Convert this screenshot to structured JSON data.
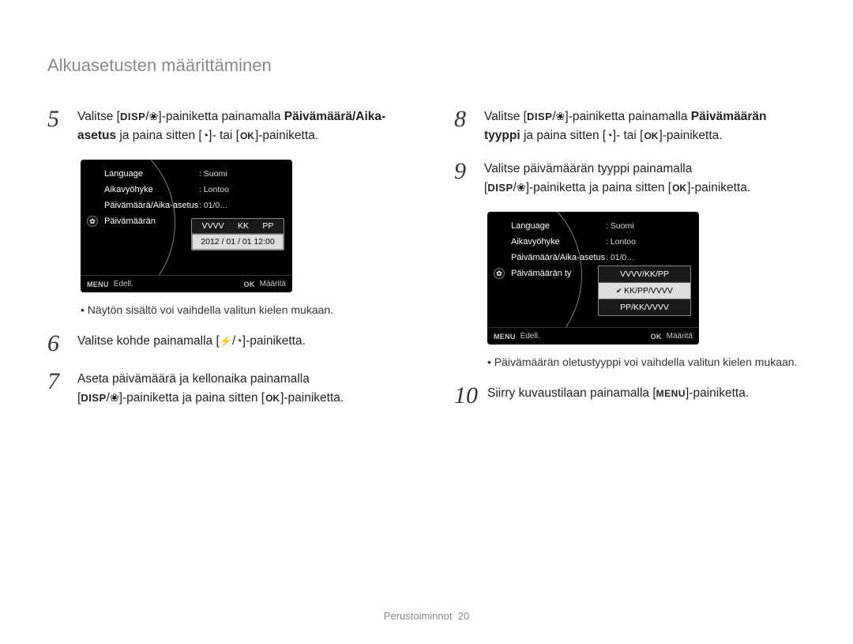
{
  "page_title": "Alkuasetusten määrittäminen",
  "footer": {
    "section": "Perustoiminnot",
    "page": "20"
  },
  "icons": {
    "disp": "DISP",
    "ok": "OK",
    "menu": "MENU"
  },
  "left": {
    "step5": {
      "num": "5",
      "pre": "Valitse [",
      "mid1": "]-painiketta painamalla ",
      "bold": "Päivämäärä/Aika-asetus",
      "mid2": " ja paina sitten [",
      "tail": "]- tai [",
      "end": "]-painiketta."
    },
    "lcd1": {
      "rows": [
        {
          "lbl": "Language",
          "val": ": Suomi"
        },
        {
          "lbl": "Aikavyöhyke",
          "val": ": Lontoo"
        },
        {
          "lbl": "Päivämäärä/Aika-asetus",
          "val": ": 01/0…"
        },
        {
          "lbl": "Päivämäärän",
          "val": ""
        }
      ],
      "dd_head": [
        "VVVV",
        "KK",
        "PP"
      ],
      "dd_val": "2012 / 01 / 01 12:00",
      "footer_left_key": "MENU",
      "footer_left": "Edell.",
      "footer_right_key": "OK",
      "footer_right": "Määritä"
    },
    "note1": "Näytön sisältö voi vaihdella valitun kielen mukaan.",
    "step6": {
      "num": "6",
      "pre": "Valitse kohde painamalla [",
      "end": "]-painiketta."
    },
    "step7": {
      "num": "7",
      "line1": "Aseta päivämäärä ja kellonaika painamalla",
      "pre2": "[",
      "mid2": "]-painiketta ja paina sitten [",
      "end2": "]-painiketta."
    }
  },
  "right": {
    "step8": {
      "num": "8",
      "pre": "Valitse [",
      "mid1": "]-painiketta painamalla ",
      "bold": "Päivämäärän tyyppi",
      "mid2": " ja paina sitten [",
      "tail": "]- tai [",
      "end": "]-painiketta."
    },
    "step9": {
      "num": "9",
      "line1": "Valitse päivämäärän tyyppi painamalla",
      "pre2": "[",
      "mid2": "]-painiketta ja paina sitten [",
      "end2": "]-painiketta."
    },
    "lcd2": {
      "rows": [
        {
          "lbl": "Language",
          "val": ": Suomi"
        },
        {
          "lbl": "Aikavyöhyke",
          "val": ": Lontoo"
        },
        {
          "lbl": "Päivämäärä/Aika-asetus",
          "val": ": 01/0…"
        },
        {
          "lbl": "Päivämäärän ty",
          "val": ""
        }
      ],
      "options": [
        "VVVV/KK/PP",
        "KK/PP/VVVV",
        "PP/KK/VVVV"
      ],
      "selected_index": 1,
      "footer_left_key": "MENU",
      "footer_left": "Edell.",
      "footer_right_key": "OK",
      "footer_right": "Määritä"
    },
    "note2": "Päivämäärän oletustyyppi voi vaihdella valitun kielen mukaan.",
    "step10": {
      "num": "10",
      "pre": "Siirry kuvaustilaan painamalla [",
      "end": "]-painiketta."
    }
  }
}
